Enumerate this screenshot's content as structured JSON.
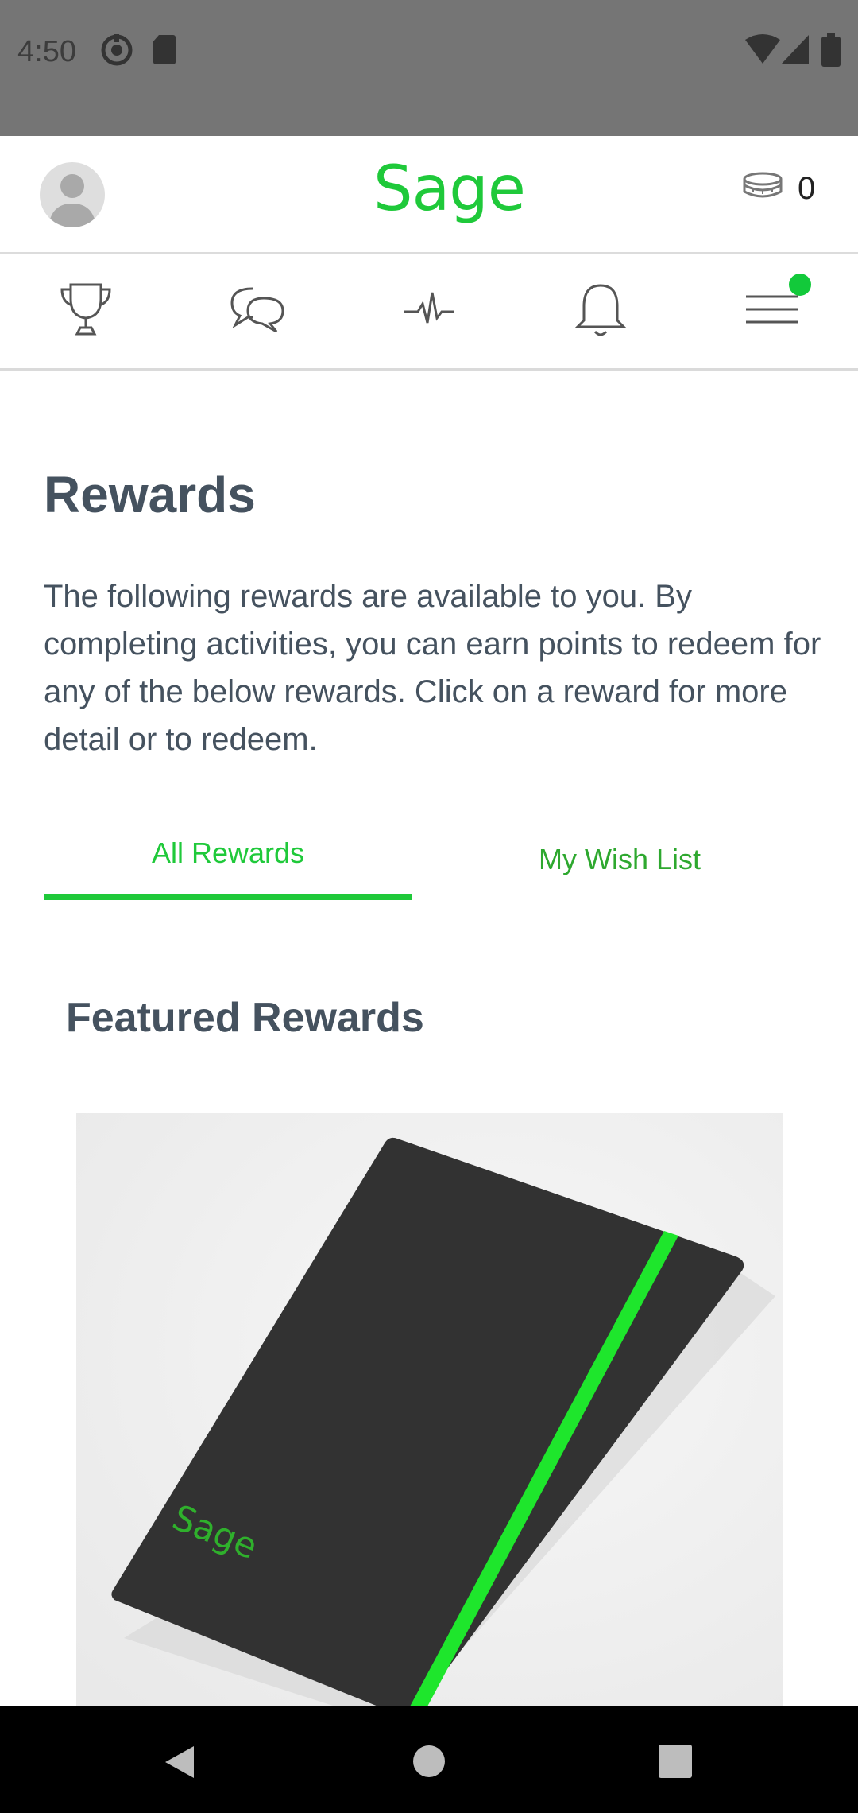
{
  "status_bar": {
    "time": "4:50"
  },
  "header": {
    "brand": "Sage",
    "points": "0",
    "icons": [
      "avatar",
      "coins-icon"
    ]
  },
  "nav": {
    "items": [
      "trophy-icon",
      "chat-icon",
      "activity-icon",
      "bell-icon",
      "menu-icon"
    ],
    "menu_has_notification": true
  },
  "content": {
    "title": "Rewards",
    "intro": "The following rewards are available to you. By completing activities, you can earn points to redeem for any of the below rewards. Click on a reward for more detail or to redeem.",
    "tabs": [
      {
        "label": "All Rewards",
        "active": true
      },
      {
        "label": "My Wish List",
        "active": false
      }
    ],
    "section_title": "Featured Rewards",
    "featured_reward": {
      "logo_text": "Sage"
    }
  },
  "colors": {
    "brand_green": "#1fc93a",
    "text_dark": "#45525f",
    "status_bar": "#757575"
  }
}
